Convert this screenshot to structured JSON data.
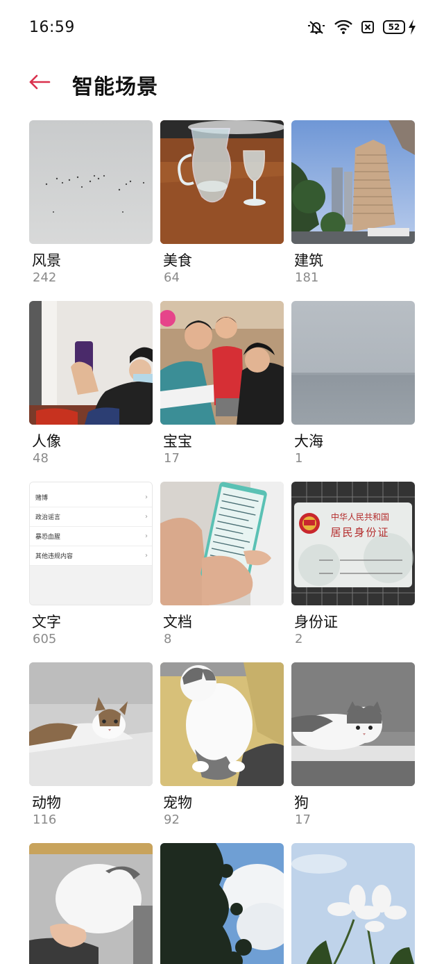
{
  "status_bar": {
    "time": "16:59",
    "battery_level": "52",
    "icons": [
      "mute-icon",
      "wifi-icon",
      "no-sim-icon",
      "battery-icon",
      "charging-icon"
    ]
  },
  "header": {
    "title": "智能场景",
    "back_icon": "back-arrow-icon",
    "accent_color": "#d9304c"
  },
  "scenes": [
    {
      "label": "风景",
      "count": "242"
    },
    {
      "label": "美食",
      "count": "64"
    },
    {
      "label": "建筑",
      "count": "181"
    },
    {
      "label": "人像",
      "count": "48"
    },
    {
      "label": "宝宝",
      "count": "17"
    },
    {
      "label": "大海",
      "count": "1"
    },
    {
      "label": "文字",
      "count": "605"
    },
    {
      "label": "文档",
      "count": "8"
    },
    {
      "label": "身份证",
      "count": "2"
    },
    {
      "label": "动物",
      "count": "116"
    },
    {
      "label": "宠物",
      "count": "92"
    },
    {
      "label": "狗",
      "count": "17"
    }
  ],
  "text_thumbnail": {
    "rows": [
      "赌博",
      "政治谣言",
      "暴恐血腥",
      "其他违规内容"
    ]
  },
  "id_card_thumbnail": {
    "line1": "中华人民共和国",
    "line2": "居民身份证"
  }
}
